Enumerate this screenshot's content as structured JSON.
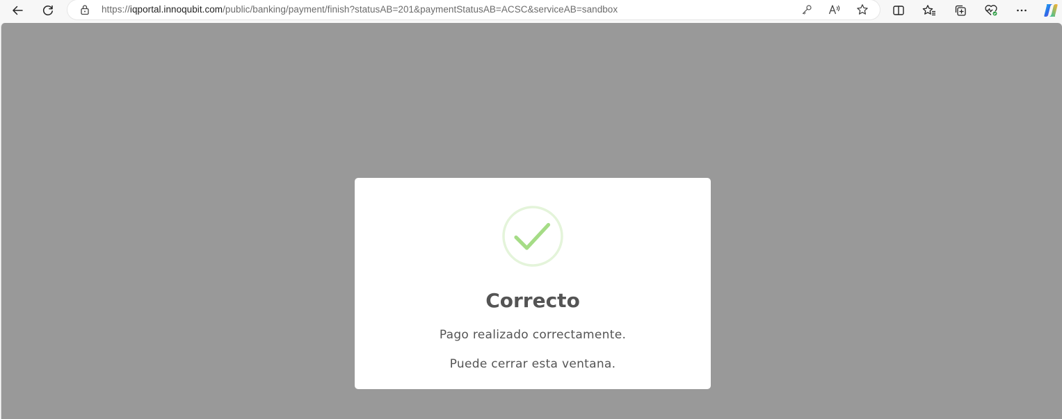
{
  "browser": {
    "url_prefix": "https://",
    "url_host": "iqportal.innoqubit.com",
    "url_path": "/public/banking/payment/finish?statusAB=201&paymentStatusAB=ACSC&serviceAB=sandbox",
    "icons": {
      "back": "arrow-left-icon",
      "refresh": "refresh-icon",
      "lock": "lock-icon",
      "key": "key-icon",
      "read_aloud": "read-aloud-icon",
      "favorite_add": "star-icon",
      "split_screen": "split-screen-icon",
      "favorites": "favorites-icon",
      "collections": "collections-icon",
      "performance": "heart-pulse-icon",
      "menu": "more-icon",
      "copilot": "copilot-icon"
    }
  },
  "dialog": {
    "icon": "checkmark-icon",
    "title": "Correcto",
    "message": "Pago realizado correctamente.",
    "note": "Puede cerrar esta ventana.",
    "colors": {
      "overlay": "#999999",
      "check": "#a5dc86",
      "ring": "#e4f4da",
      "text": "#545454"
    }
  }
}
